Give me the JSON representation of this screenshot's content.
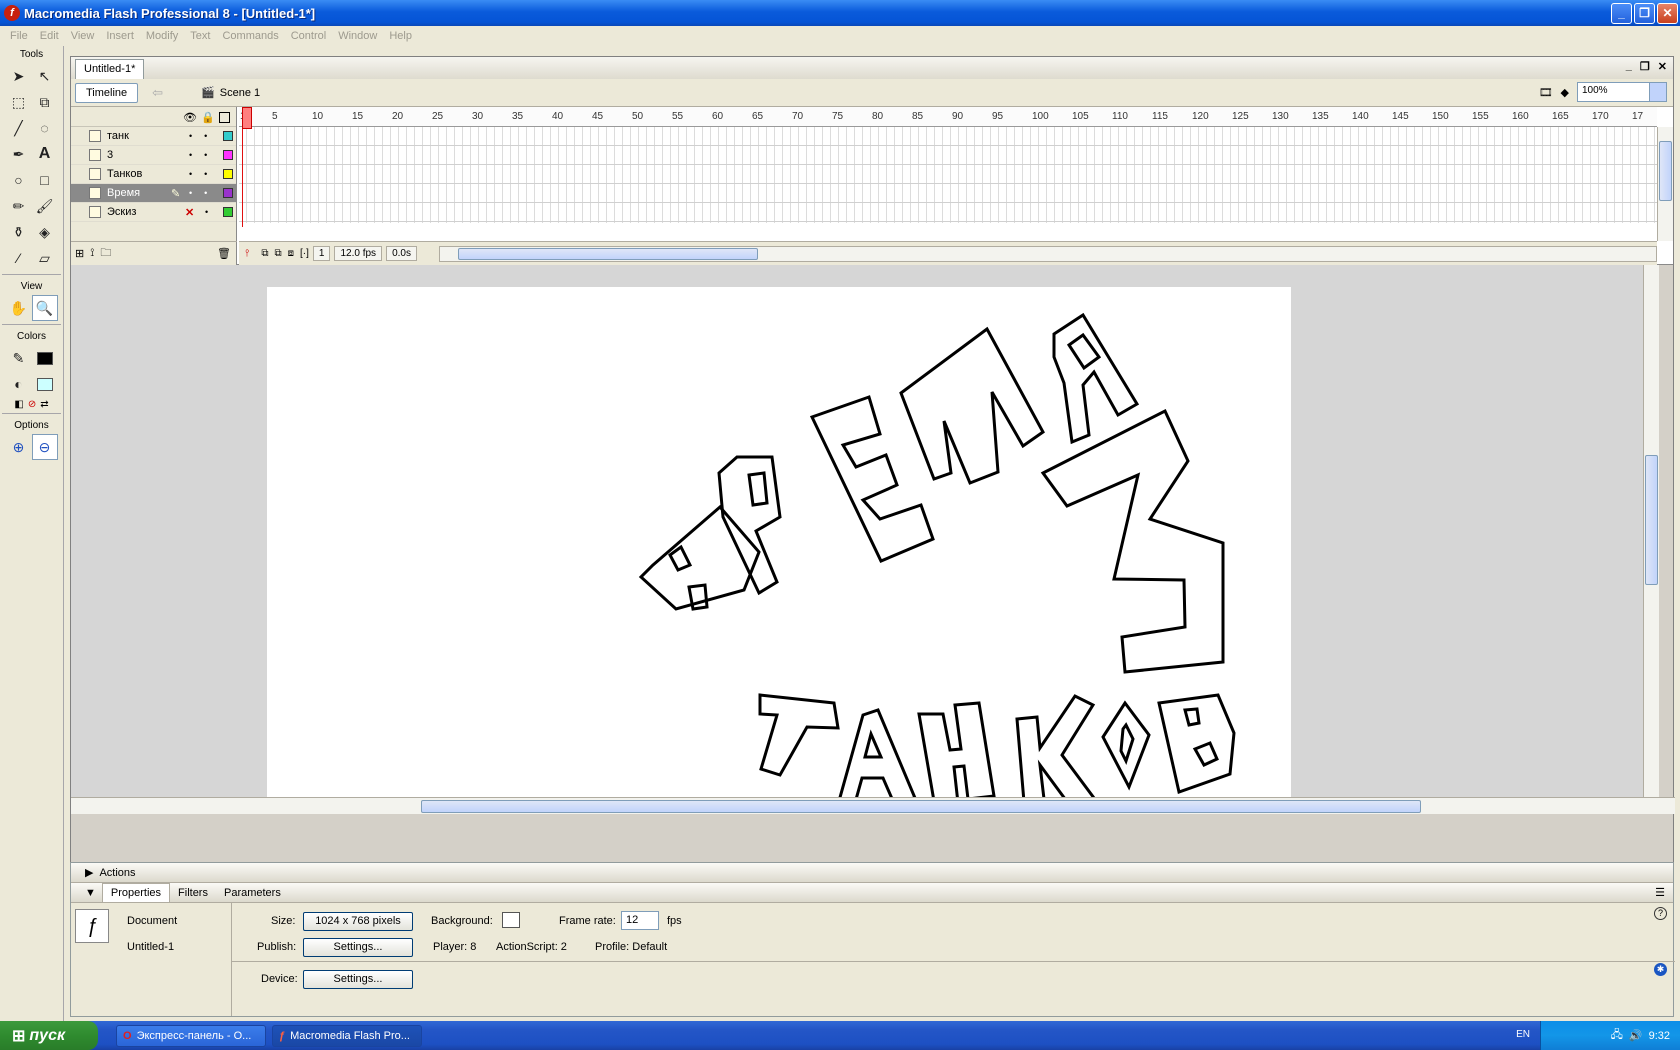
{
  "window": {
    "title": "Macromedia Flash Professional 8 - [Untitled-1*]"
  },
  "menu": [
    "File",
    "Edit",
    "View",
    "Insert",
    "Modify",
    "Text",
    "Commands",
    "Control",
    "Window",
    "Help"
  ],
  "tools": {
    "title": "Tools",
    "view_label": "View",
    "colors_label": "Colors",
    "options_label": "Options",
    "stroke_color": "#000000",
    "fill_color": "#ccffff"
  },
  "document": {
    "tab": "Untitled-1*",
    "timeline_button": "Timeline",
    "scene": "Scene 1",
    "zoom": "100%"
  },
  "timeline": {
    "layers": [
      {
        "name": "танк",
        "color": "#33cccc"
      },
      {
        "name": "3",
        "color": "#ff33ff"
      },
      {
        "name": "Танков",
        "color": "#ffff00"
      },
      {
        "name": "Время",
        "color": "#9933cc"
      },
      {
        "name": "Эскиз",
        "color": "#33cc33"
      }
    ],
    "ruler": [
      "1",
      "5",
      "10",
      "15",
      "20",
      "25",
      "30",
      "35",
      "40",
      "45",
      "50",
      "55",
      "60",
      "65",
      "70",
      "75",
      "80",
      "85",
      "90",
      "95",
      "100",
      "105",
      "110",
      "115",
      "120",
      "125",
      "130",
      "135",
      "140",
      "145",
      "150",
      "155",
      "160",
      "165",
      "170",
      "17"
    ],
    "current_frame": "1",
    "fps": "12.0 fps",
    "time": "0.0s"
  },
  "panels": {
    "actions": "Actions",
    "tabs": [
      "Properties",
      "Filters",
      "Parameters"
    ],
    "doc_type": "Document",
    "doc_name": "Untitled-1",
    "size_label": "Size:",
    "size_value": "1024 x 768 pixels",
    "background_label": "Background:",
    "frame_rate_label": "Frame rate:",
    "frame_rate_value": "12",
    "fps_unit": "fps",
    "publish_label": "Publish:",
    "settings_button": "Settings...",
    "player": "Player: 8",
    "actionscript": "ActionScript: 2",
    "profile": "Profile:  Default",
    "device_label": "Device:"
  },
  "taskbar": {
    "start": "пуск",
    "items": [
      "Экспресс-панель - O...",
      "Macromedia Flash Pro..."
    ],
    "lang": "EN",
    "clock": "9:32"
  }
}
